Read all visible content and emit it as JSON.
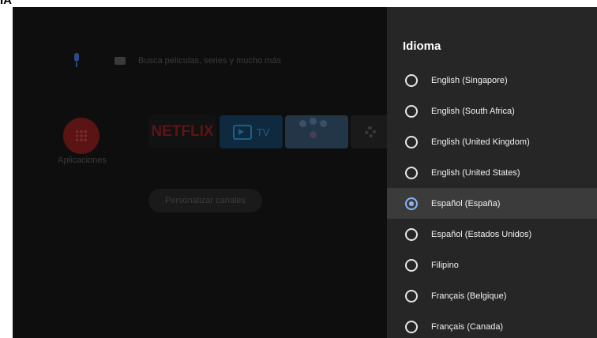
{
  "corner_text": "IA",
  "home": {
    "search_placeholder": "Busca películas, series y mucho más",
    "apps_label": "Aplicaciones",
    "netflix_label": "NETFLIX",
    "tv_label": "TV",
    "customize_channels": "Personalizar canales"
  },
  "panel": {
    "title": "Idioma",
    "accent_color": "#8ab4f8",
    "options": [
      {
        "label": "English (Singapore)",
        "selected": false
      },
      {
        "label": "English (South Africa)",
        "selected": false
      },
      {
        "label": "English (United Kingdom)",
        "selected": false
      },
      {
        "label": "English (United States)",
        "selected": false
      },
      {
        "label": "Español (España)",
        "selected": true
      },
      {
        "label": "Español (Estados Unidos)",
        "selected": false
      },
      {
        "label": "Filipino",
        "selected": false
      },
      {
        "label": "Français (Belgique)",
        "selected": false
      },
      {
        "label": "Français (Canada)",
        "selected": false
      }
    ]
  }
}
